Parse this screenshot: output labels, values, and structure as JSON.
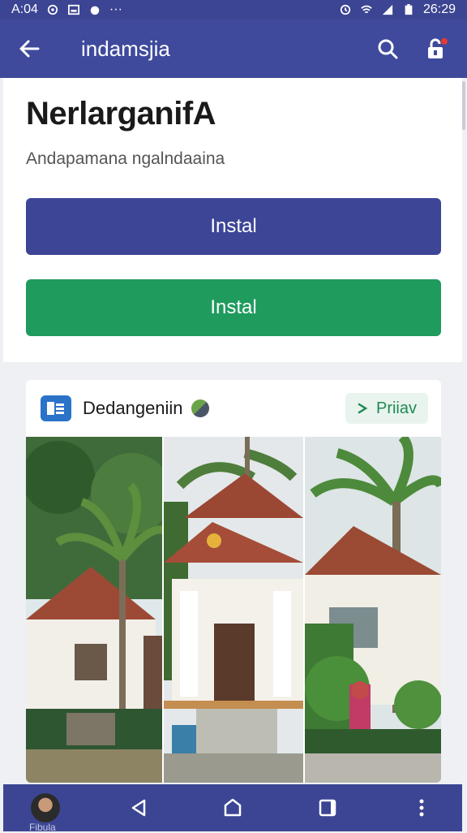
{
  "status_bar": {
    "time_left": "A:04",
    "time_right": "26:29"
  },
  "app_bar": {
    "title": "indamsjia"
  },
  "header": {
    "title": "NerlarganifA",
    "subtitle": "Andapamana ngalndaaina"
  },
  "buttons": {
    "install_primary": "Instal",
    "install_secondary": "Instal"
  },
  "listing": {
    "name": "Dedangeniin",
    "preview_label": "Priiav"
  },
  "bottom_nav": {
    "profile_label": "Fibula"
  },
  "colors": {
    "primary": "#3f4a9c",
    "green": "#1f9b5e",
    "statusbar": "#3c4593"
  },
  "icons": [
    "back-arrow-icon",
    "search-icon",
    "lock-icon",
    "back-nav-icon",
    "home-nav-icon",
    "recents-nav-icon",
    "more-icon"
  ]
}
